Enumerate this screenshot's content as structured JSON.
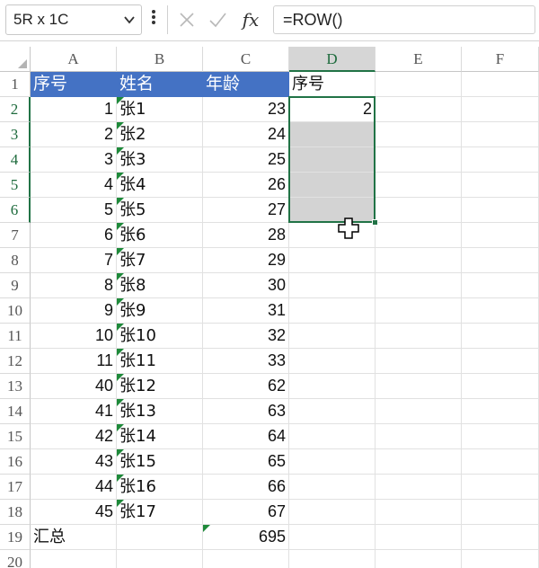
{
  "formula_bar": {
    "name_box": "5R x 1C",
    "formula": "=ROW()",
    "fx_label": "fx",
    "cancel_icon": "x-icon",
    "confirm_icon": "check-icon"
  },
  "columns": [
    "A",
    "B",
    "C",
    "D",
    "E",
    "F"
  ],
  "rows": [
    "1",
    "2",
    "3",
    "4",
    "5",
    "6",
    "7",
    "8",
    "9",
    "10",
    "11",
    "12",
    "13",
    "14",
    "15",
    "16",
    "17",
    "18",
    "19",
    "20"
  ],
  "header_row": {
    "a": "序号",
    "b": "姓名",
    "c": "年龄",
    "d": "序号"
  },
  "data_rows": [
    {
      "a": "1",
      "b": "张1",
      "c": "23"
    },
    {
      "a": "2",
      "b": "张2",
      "c": "24"
    },
    {
      "a": "3",
      "b": "张3",
      "c": "25"
    },
    {
      "a": "4",
      "b": "张4",
      "c": "26"
    },
    {
      "a": "5",
      "b": "张5",
      "c": "27"
    },
    {
      "a": "6",
      "b": "张6",
      "c": "28"
    },
    {
      "a": "7",
      "b": "张7",
      "c": "29"
    },
    {
      "a": "8",
      "b": "张8",
      "c": "30"
    },
    {
      "a": "9",
      "b": "张9",
      "c": "31"
    },
    {
      "a": "10",
      "b": "张10",
      "c": "32"
    },
    {
      "a": "11",
      "b": "张11",
      "c": "33"
    },
    {
      "a": "40",
      "b": "张12",
      "c": "62"
    },
    {
      "a": "41",
      "b": "张13",
      "c": "63"
    },
    {
      "a": "42",
      "b": "张14",
      "c": "64"
    },
    {
      "a": "43",
      "b": "张15",
      "c": "65"
    },
    {
      "a": "44",
      "b": "张16",
      "c": "66"
    },
    {
      "a": "45",
      "b": "张17",
      "c": "67"
    }
  ],
  "summary_row": {
    "a": "汇总",
    "c": "695"
  },
  "d_values": {
    "d2": "2"
  },
  "selection": {
    "column": "D",
    "rows": [
      "2",
      "3",
      "4",
      "5",
      "6"
    ]
  },
  "colors": {
    "header_fill": "#4472c4",
    "selection_border": "#217346",
    "selection_fill": "#d3d3d3",
    "error_triangle": "#1e8a3a"
  }
}
